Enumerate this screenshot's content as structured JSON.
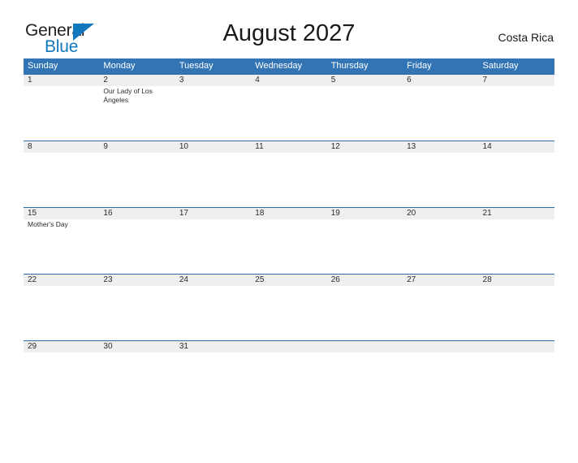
{
  "brand": {
    "name_part1": "General",
    "name_part2": "Blue",
    "flag_icon": "flag-triangle-icon",
    "color_dark": "#231f20",
    "color_blue": "#1278be"
  },
  "header": {
    "title": "August 2027",
    "region": "Costa Rica"
  },
  "theme": {
    "header_blue": "#3374b5",
    "row_divider_blue": "#2f6ca8",
    "daynum_band": "#efefef"
  },
  "weekdays": [
    {
      "label": "Sunday"
    },
    {
      "label": "Monday"
    },
    {
      "label": "Tuesday"
    },
    {
      "label": "Wednesday"
    },
    {
      "label": "Thursday"
    },
    {
      "label": "Friday"
    },
    {
      "label": "Saturday"
    }
  ],
  "weeks": [
    {
      "days": [
        {
          "num": "1",
          "event": ""
        },
        {
          "num": "2",
          "event": "Our Lady of Los Ángeles"
        },
        {
          "num": "3",
          "event": ""
        },
        {
          "num": "4",
          "event": ""
        },
        {
          "num": "5",
          "event": ""
        },
        {
          "num": "6",
          "event": ""
        },
        {
          "num": "7",
          "event": ""
        }
      ]
    },
    {
      "days": [
        {
          "num": "8",
          "event": ""
        },
        {
          "num": "9",
          "event": ""
        },
        {
          "num": "10",
          "event": ""
        },
        {
          "num": "11",
          "event": ""
        },
        {
          "num": "12",
          "event": ""
        },
        {
          "num": "13",
          "event": ""
        },
        {
          "num": "14",
          "event": ""
        }
      ]
    },
    {
      "days": [
        {
          "num": "15",
          "event": "Mother's Day"
        },
        {
          "num": "16",
          "event": ""
        },
        {
          "num": "17",
          "event": ""
        },
        {
          "num": "18",
          "event": ""
        },
        {
          "num": "19",
          "event": ""
        },
        {
          "num": "20",
          "event": ""
        },
        {
          "num": "21",
          "event": ""
        }
      ]
    },
    {
      "days": [
        {
          "num": "22",
          "event": ""
        },
        {
          "num": "23",
          "event": ""
        },
        {
          "num": "24",
          "event": ""
        },
        {
          "num": "25",
          "event": ""
        },
        {
          "num": "26",
          "event": ""
        },
        {
          "num": "27",
          "event": ""
        },
        {
          "num": "28",
          "event": ""
        }
      ]
    },
    {
      "days": [
        {
          "num": "29",
          "event": ""
        },
        {
          "num": "30",
          "event": ""
        },
        {
          "num": "31",
          "event": ""
        },
        {
          "num": "",
          "event": ""
        },
        {
          "num": "",
          "event": ""
        },
        {
          "num": "",
          "event": ""
        },
        {
          "num": "",
          "event": ""
        }
      ]
    }
  ]
}
